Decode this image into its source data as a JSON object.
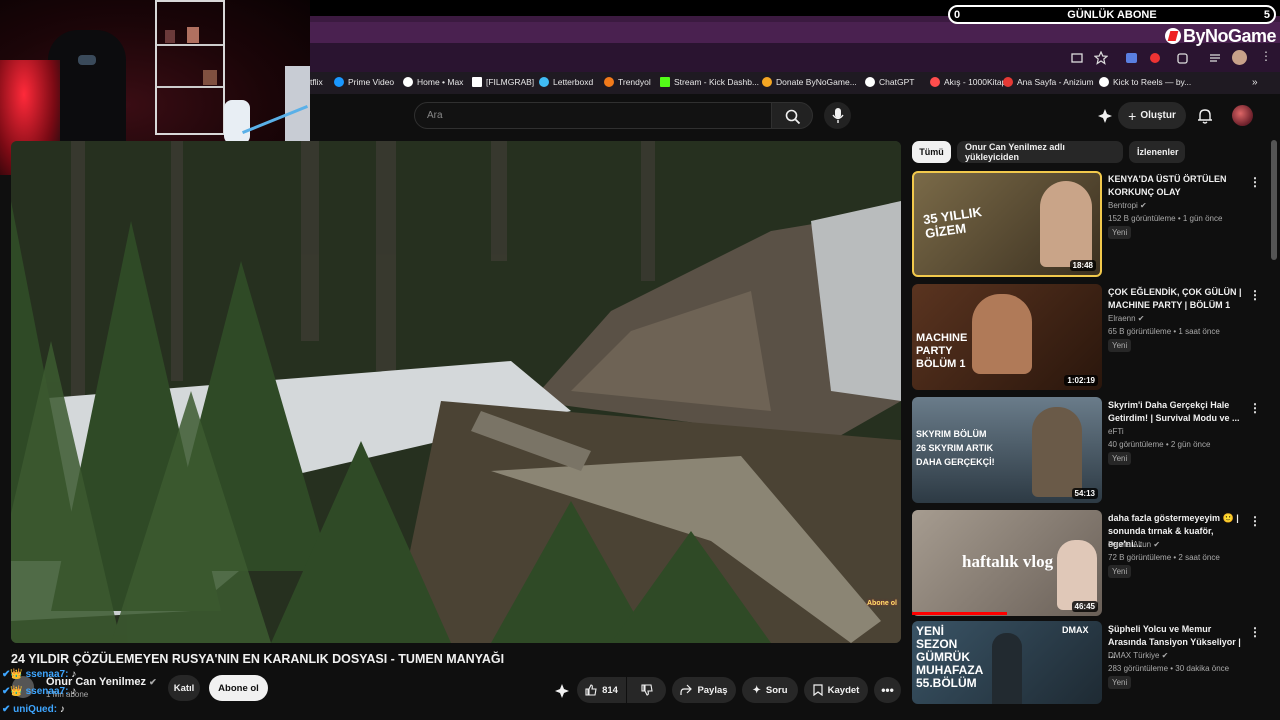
{
  "overlay": {
    "subs_label": "GÜNLÜK ABONE",
    "subs_current": "0",
    "subs_goal": "5",
    "brand": "ByNoGame"
  },
  "bookmarks": [
    {
      "label": "tflix",
      "color": "#e50914"
    },
    {
      "label": "Prime Video",
      "color": "#1a98ff"
    },
    {
      "label": "Home • Max",
      "color": "#ffffff"
    },
    {
      "label": "[FILMGRAB]",
      "color": "#ffffff"
    },
    {
      "label": "Letterboxd",
      "color": "#40bcf4"
    },
    {
      "label": "Trendyol",
      "color": "#f27a1a"
    },
    {
      "label": "Stream - Kick Dashb...",
      "color": "#53fc18"
    },
    {
      "label": "Donate ByNoGame...",
      "color": "#f5a623"
    },
    {
      "label": "ChatGPT",
      "color": "#ffffff"
    },
    {
      "label": "Akış - 1000Kitap",
      "color": "#ff4d4d"
    },
    {
      "label": "Ana Sayfa - Anizium",
      "color": "#e53935"
    },
    {
      "label": "Kick to Reels — by...",
      "color": "#ffffff"
    }
  ],
  "header": {
    "search_placeholder": "Ara",
    "create_label": "Oluştur"
  },
  "video": {
    "title": "24 YILDIR ÇÖZÜLEMEYEN RUSYA'NIN EN KARANLIK DOSYASI - TUMEN MANYAĞI",
    "watermark": "Abone ol",
    "channel": "Onur Can Yenilmez",
    "subscribers": "1 Mn abone",
    "join_label": "Katıl",
    "subscribe_label": "Abone ol",
    "likes": "814",
    "share_label": "Paylaş",
    "ask_label": "Soru",
    "save_label": "Kaydet"
  },
  "chips": [
    "Tümü",
    "Onur Can Yenilmez adlı yükleyiciden",
    "İzlenenler"
  ],
  "recommendations": [
    {
      "title": "KENYA'DA ÜSTÜ ÖRTÜLEN KORKUNÇ OLAY",
      "channel": "Bentropi",
      "meta": "152 B görüntüleme • 1 gün önce",
      "badge": "Yeni",
      "duration": "18:48",
      "thumb_text": "35 YILLIK GİZEM",
      "bg": "#6b5a3a"
    },
    {
      "title": "ÇOK EĞLENDİK, ÇOK GÜLÜN | MACHINE PARTY | BÖLÜM 1",
      "channel": "Elraenn",
      "meta": "65 B görüntüleme • 1 saat önce",
      "badge": "Yeni",
      "duration": "1:02:19",
      "thumb_text": "MACHINE PARTY BÖLÜM 1",
      "bg": "#4a2a18"
    },
    {
      "title": "Skyrim'i Daha Gerçekçi Hale Getirdim! | Survival Modu ve ...",
      "channel": "eFTi",
      "meta": "40 görüntüleme • 2 gün önce",
      "badge": "Yeni",
      "duration": "54:13",
      "thumb_text": "SKYRIM BÖLÜM 26 SKYRIM ARTIK DAHA GERÇEKÇİ!",
      "bg": "#3d4a55"
    },
    {
      "title": "daha fazla göstermeyeyim 🙂 | sonunda tırnak & kuaför, ege'ni...",
      "channel": "Damla Altun",
      "meta": "72 B görüntüleme • 2 saat önce",
      "badge": "Yeni",
      "duration": "46:45",
      "thumb_text": "haftalık vlog",
      "bg": "#8a8178"
    },
    {
      "title": "Şüpheli Yolcu ve Memur Arasında Tansiyon Yükseliyor | ...",
      "channel": "DMAX Türkiye",
      "meta": "283 görüntüleme • 30 dakika önce",
      "badge": "Yeni",
      "duration": "",
      "thumb_text": "YENİ SEZON GÜMRÜK MUHAFAZA 55.BÖLÜM",
      "bg": "#2a3e4a"
    }
  ],
  "chat": [
    {
      "user": "ssenaa7:",
      "msg": "♪"
    },
    {
      "user": "ssenaa7:",
      "msg": "♪"
    },
    {
      "user": "uniQued:",
      "msg": "♪"
    }
  ]
}
